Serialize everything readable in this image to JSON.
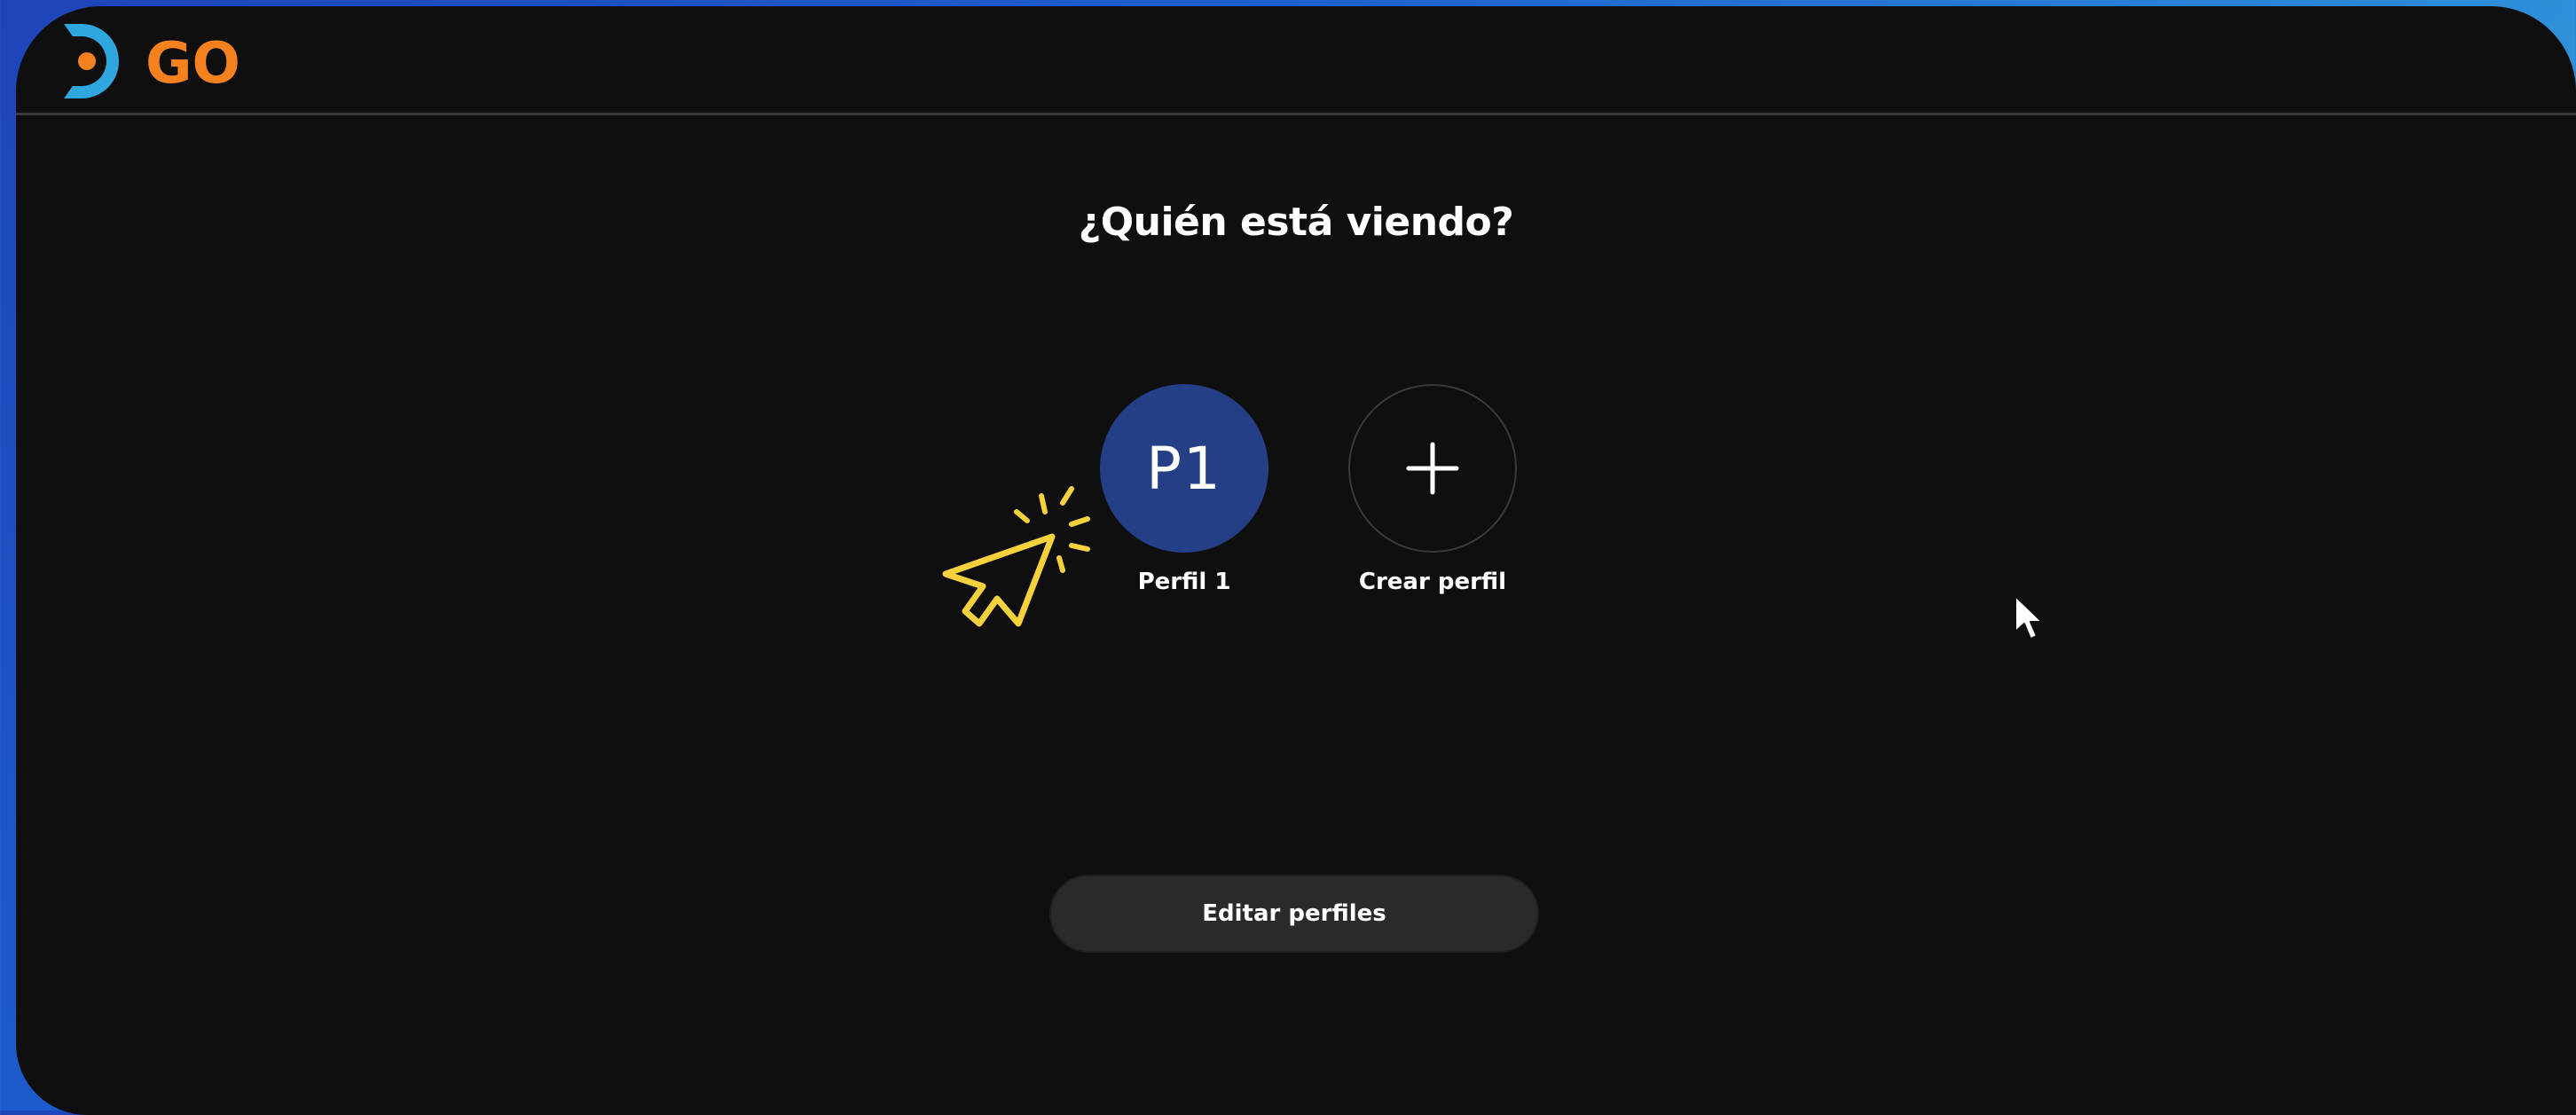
{
  "app": {
    "logo_text": "GO",
    "brand_colors": {
      "orange": "#f5821f",
      "blue": "#2fa6de"
    }
  },
  "page": {
    "title": "¿Quién está viendo?"
  },
  "profiles": [
    {
      "initials": "P1",
      "label": "Perfil 1",
      "color": "#243f86"
    },
    {
      "icon": "plus-icon",
      "label": "Crear perfil"
    }
  ],
  "actions": {
    "edit_label": "Editar perfiles"
  },
  "overlay": {
    "click_indicator_icon": "click-cursor-icon",
    "click_indicator_color": "#f5d23c",
    "pointer_icon": "mouse-pointer-icon"
  }
}
